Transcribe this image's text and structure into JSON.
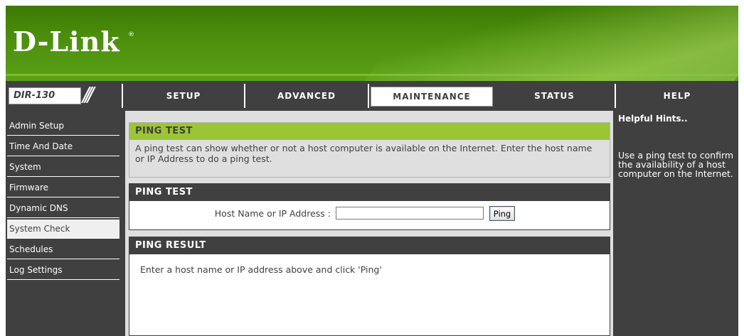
{
  "brand": {
    "logo": "D-Link",
    "reg": "®"
  },
  "nav": {
    "model": "DIR-130",
    "tabs": [
      {
        "label": "SETUP"
      },
      {
        "label": "ADVANCED"
      },
      {
        "label": "MAINTENANCE",
        "active": true
      },
      {
        "label": "STATUS"
      },
      {
        "label": "HELP"
      }
    ]
  },
  "sidebar": {
    "items": [
      {
        "label": "Admin Setup"
      },
      {
        "label": "Time And Date"
      },
      {
        "label": "System"
      },
      {
        "label": "Firmware"
      },
      {
        "label": "Dynamic DNS"
      },
      {
        "label": "System Check",
        "active": true
      },
      {
        "label": "Schedules"
      },
      {
        "label": "Log Settings"
      }
    ]
  },
  "intro": {
    "title": "PING TEST",
    "text": "A ping test can show whether or not a host computer is available on the Internet. Enter the host name or IP Address to do a ping test."
  },
  "ping": {
    "title": "PING TEST",
    "label": "Host Name or IP Address :",
    "value": "",
    "button": "Ping"
  },
  "result": {
    "title": "PING RESULT",
    "text": "Enter a host name or IP address above and click 'Ping'"
  },
  "hints": {
    "title": "Helpful Hints..",
    "text": "Use a ping test to confirm the availability of a host computer on the Internet."
  },
  "colors": {
    "header_green": "#4c8f0d",
    "section_green": "#9cc536",
    "dark": "#404040",
    "panel": "#dfdfdf"
  }
}
